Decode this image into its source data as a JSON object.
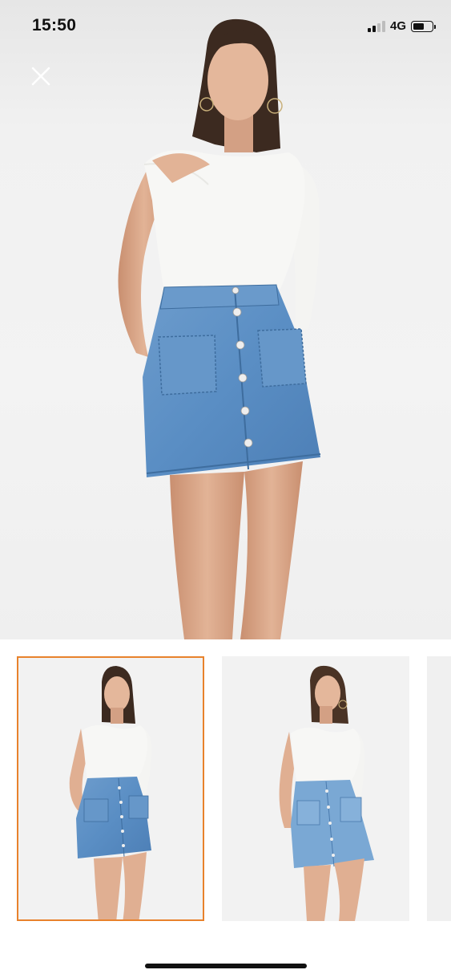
{
  "status_bar": {
    "time": "15:50",
    "network": "4G",
    "signal_bars_active": 2,
    "signal_bars_total": 4,
    "battery_level": 0.55
  },
  "viewer": {
    "close_icon": "close-icon",
    "main_image": "product-photo-front",
    "accent_color": "#e8822c"
  },
  "thumbnails": [
    {
      "name": "product-photo-front",
      "selected": true
    },
    {
      "name": "product-photo-angle",
      "selected": false
    },
    {
      "name": "product-photo-next",
      "selected": false
    }
  ],
  "colors": {
    "denim": "#5b8fc4",
    "top": "#f7f7f5",
    "skin": "#d9a98b",
    "hair": "#3c2a20"
  }
}
